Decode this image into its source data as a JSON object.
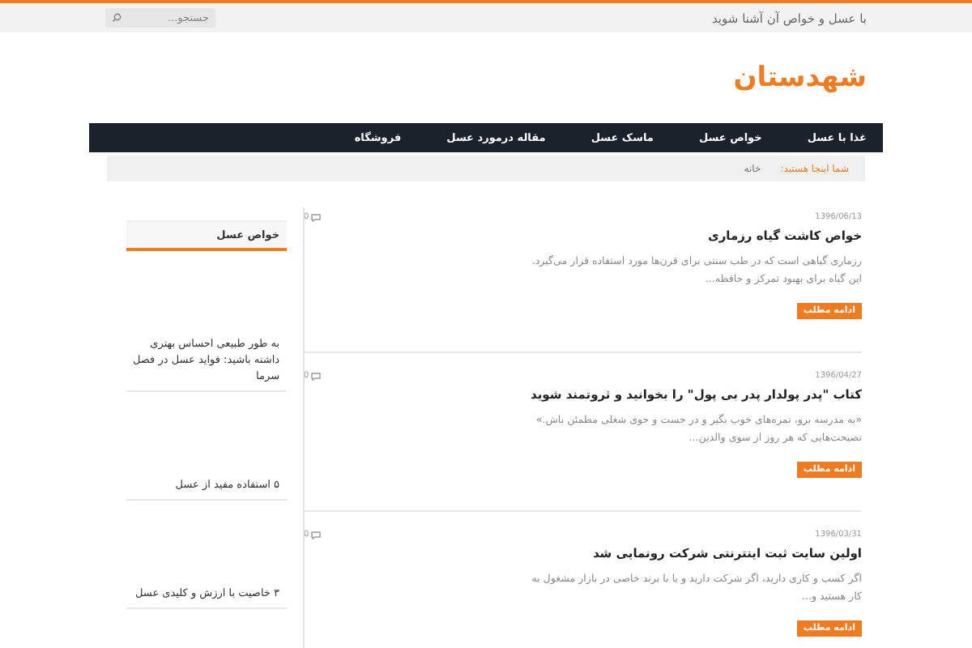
{
  "topbar": {
    "tagline": "با عسل و خواص آن آشنا شوید",
    "search": {
      "placeholder": "جستجو..."
    }
  },
  "logo": "شهدستان",
  "nav": [
    "غذا با عسل",
    "خواص عسل",
    "ماسک عسل",
    "مقاله درمورد عسل",
    "فروشگاه"
  ],
  "breadcrumb": {
    "label": "شما اینجا هستید:",
    "items": [
      "خانه"
    ]
  },
  "posts": [
    {
      "date": "1396/06/13",
      "comments": "0",
      "title": "خواص کاشت گیاه رزماری",
      "excerpt": "رزماری گیاهی است که در طب سنتی برای قرن‌ها مورد استفاده قرار می‌گیرد. این گیاه برای بهبود تمرکز و حافظه...",
      "button": "ادامه مطلب"
    },
    {
      "date": "1396/04/27",
      "comments": "0",
      "title": "کتاب \"پدر پولدار پدر بی پول\" را بخوانید و ثروتمند شوید",
      "excerpt": "«به مدرسه برو، نمره‌های خوب بگیر و در جست و جوی شغلی مطمئن باش.» نصیحت‌هایی که هر روز از سوی والدین...",
      "button": "ادامه مطلب"
    },
    {
      "date": "1396/03/31",
      "comments": "0",
      "title": "اولین سایت ثبت اینترنتی شرکت رونمایی شد",
      "excerpt": "اگر کسب و کاری دارید، اگر شرکت دارید و یا با برند خاصی در بازار مشغول به کار هستید و...",
      "button": "ادامه مطلب"
    }
  ],
  "sidebar": {
    "title": "خواص عسل",
    "items": [
      "به طور طبیعی احساس بهتری داشته باشید: فواید عسل در فصل سرما",
      "۵ استفاده مفید از عسل",
      "۳ خاصیت با ارزش و کلیدی عسل"
    ]
  }
}
